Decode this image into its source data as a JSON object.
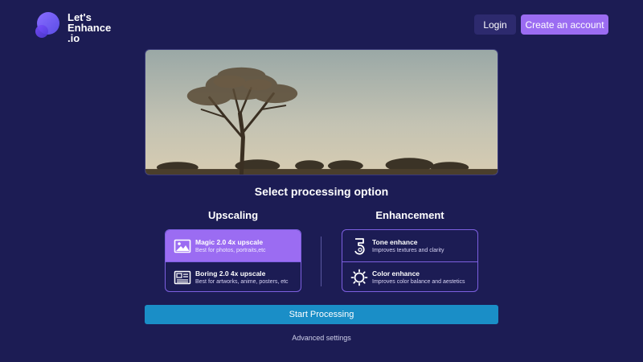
{
  "header": {
    "logo_line1": "Let's",
    "logo_line2": "Enhance",
    "logo_line3": ".io",
    "login_label": "Login",
    "create_account_label": "Create an account"
  },
  "main": {
    "section_title": "Select processing option",
    "upscaling": {
      "title": "Upscaling",
      "options": [
        {
          "name": "Magic 2.0 4x upscale",
          "desc": "Best for photos, portraits,etc",
          "icon": "image-icon",
          "selected": true
        },
        {
          "name": "Boring 2.0 4x upscale",
          "desc": "Best for artworks, anime, posters, etc",
          "icon": "newspaper-icon",
          "selected": false
        }
      ]
    },
    "enhancement": {
      "title": "Enhancement",
      "options": [
        {
          "name": "Tone enhance",
          "desc": "Improves textures and clarity",
          "icon": "tone-icon",
          "selected": false
        },
        {
          "name": "Color enhance",
          "desc": "Improves color balance and aestetics",
          "icon": "sun-icon",
          "selected": false
        }
      ]
    },
    "start_label": "Start Processing",
    "advanced_label": "Advanced settings"
  },
  "colors": {
    "background": "#1c1c54",
    "accent": "#9b6cf2",
    "primary_button": "#1a8ec7"
  }
}
